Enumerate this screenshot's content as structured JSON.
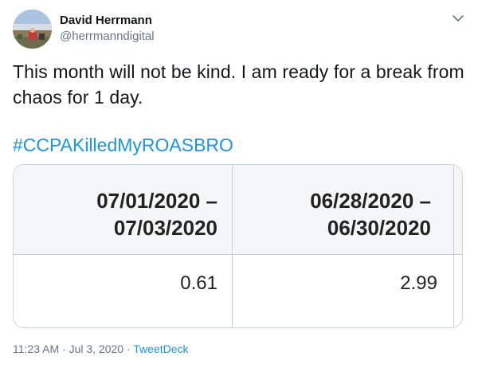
{
  "author": {
    "display_name": "David Herrmann",
    "handle": "@herrmanndigital",
    "avatar_icon": "profile-photo"
  },
  "tweet": {
    "text": "This month will not be kind. I am ready for a break from chaos for 1 day.",
    "hashtag": "#CCPAKilledMyROASBRO"
  },
  "media": {
    "columns": [
      {
        "header_line1": "07/01/2020 –",
        "header_line2": "07/03/2020",
        "value": "0.61"
      },
      {
        "header_line1": "06/28/2020 –",
        "header_line2": "06/30/2020",
        "value": "2.99"
      }
    ]
  },
  "meta": {
    "time": "11:23 AM",
    "separator1": " · ",
    "date": "Jul 3, 2020",
    "separator2": " · ",
    "source": "TweetDeck"
  },
  "colors": {
    "link": "#1b95e0",
    "muted": "#657786",
    "text": "#14171a"
  },
  "icons": {
    "menu": "chevron-down-icon"
  }
}
